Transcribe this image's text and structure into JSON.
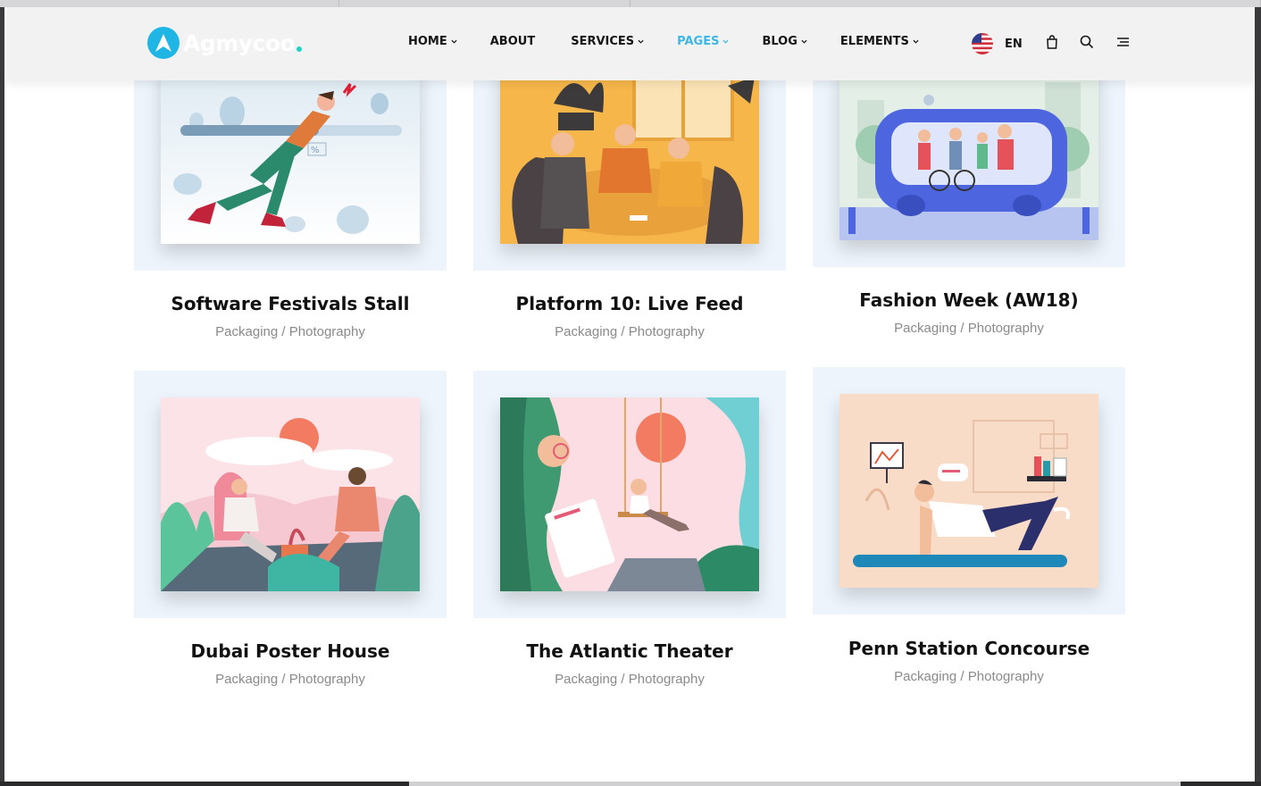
{
  "brand": {
    "name": "Agmycoo"
  },
  "nav": [
    {
      "label": "HOME",
      "has_dropdown": true,
      "active": false
    },
    {
      "label": "ABOUT",
      "has_dropdown": false,
      "active": false
    },
    {
      "label": "SERVICES",
      "has_dropdown": true,
      "active": false
    },
    {
      "label": "PAGES",
      "has_dropdown": true,
      "active": true
    },
    {
      "label": "BLOG",
      "has_dropdown": true,
      "active": false
    },
    {
      "label": "ELEMENTS",
      "has_dropdown": true,
      "active": false
    }
  ],
  "header_tools": {
    "language": "EN",
    "flag_icon": "us-flag-icon",
    "cart_icon": "shopping-bag-icon",
    "search_icon": "search-icon",
    "menu_icon": "hamburger-menu-icon"
  },
  "colors": {
    "accent": "#3fb7e6",
    "logo": "#1fb6e6",
    "card_bg": "#edf4fb"
  },
  "portfolio": [
    {
      "title": "Software Festivals Stall",
      "cat1": "Packaging",
      "sep": " / ",
      "cat2": "Photography"
    },
    {
      "title": "Platform 10: Live Feed",
      "cat1": "Packaging",
      "sep": " / ",
      "cat2": "Photography"
    },
    {
      "title": "Fashion Week (AW18)",
      "cat1": "Packaging",
      "sep": " / ",
      "cat2": "Photography"
    },
    {
      "title": "Dubai Poster House",
      "cat1": "Packaging",
      "sep": " / ",
      "cat2": "Photography"
    },
    {
      "title": "The Atlantic Theater",
      "cat1": "Packaging",
      "sep": " / ",
      "cat2": "Photography"
    },
    {
      "title": "Penn Station Concourse",
      "cat1": "Packaging",
      "sep": " / ",
      "cat2": "Photography"
    }
  ]
}
